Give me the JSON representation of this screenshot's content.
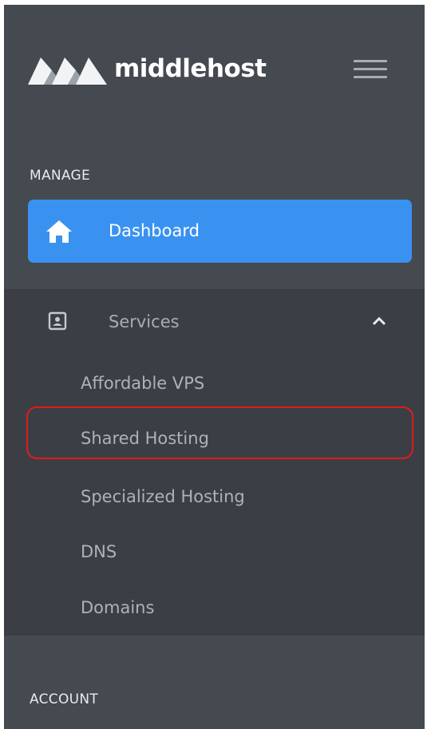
{
  "brand": {
    "name": "middlehost",
    "logo_icon": "mountain-peaks-logo"
  },
  "header": {
    "menu_icon": "hamburger-icon"
  },
  "sections": {
    "manage": "MANAGE",
    "account": "ACCOUNT"
  },
  "nav": {
    "dashboard": {
      "label": "Dashboard",
      "icon": "home-icon",
      "active": true
    },
    "services": {
      "label": "Services",
      "icon": "contact-card-icon",
      "expanded": true,
      "items": [
        {
          "label": "Affordable VPS"
        },
        {
          "label": "Shared Hosting",
          "highlighted": true
        },
        {
          "label": "Specialized Hosting"
        },
        {
          "label": "DNS"
        },
        {
          "label": "Domains"
        }
      ]
    }
  },
  "colors": {
    "sidebar_bg": "#454950",
    "submenu_bg": "#3b3e45",
    "accent": "#3a92f0",
    "highlight_ring": "#e21b1b"
  }
}
